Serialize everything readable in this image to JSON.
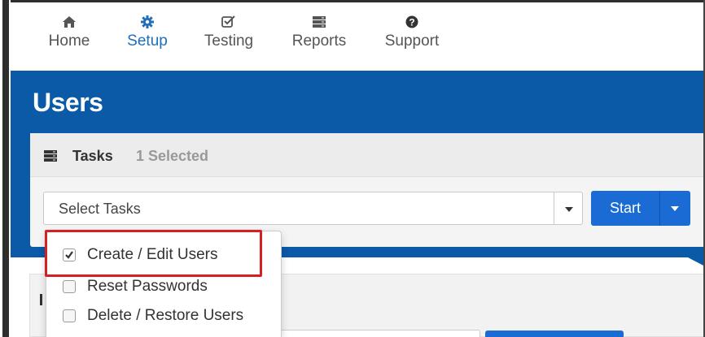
{
  "nav": {
    "items": [
      {
        "label": "Home",
        "icon": "home-icon",
        "active": false
      },
      {
        "label": "Setup",
        "icon": "gear-icon",
        "active": true
      },
      {
        "label": "Testing",
        "icon": "checkbox-icon",
        "active": false
      },
      {
        "label": "Reports",
        "icon": "server-icon",
        "active": false
      },
      {
        "label": "Support",
        "icon": "question-circle-icon",
        "active": false
      }
    ]
  },
  "page": {
    "title": "Users"
  },
  "tasks": {
    "title": "Tasks",
    "selected_count": "1 Selected",
    "select_placeholder": "Select Tasks",
    "start_label": "Start"
  },
  "menu": {
    "items": [
      {
        "label": "Create / Edit Users",
        "checked": true
      },
      {
        "label": "Reset Passwords",
        "checked": false
      },
      {
        "label": "Delete / Restore Users",
        "checked": false
      }
    ]
  },
  "colors": {
    "header_blue": "#0a5aa8",
    "button_blue": "#1a6cd4",
    "active_nav": "#1e6fb8",
    "highlight_red": "#d62020"
  }
}
